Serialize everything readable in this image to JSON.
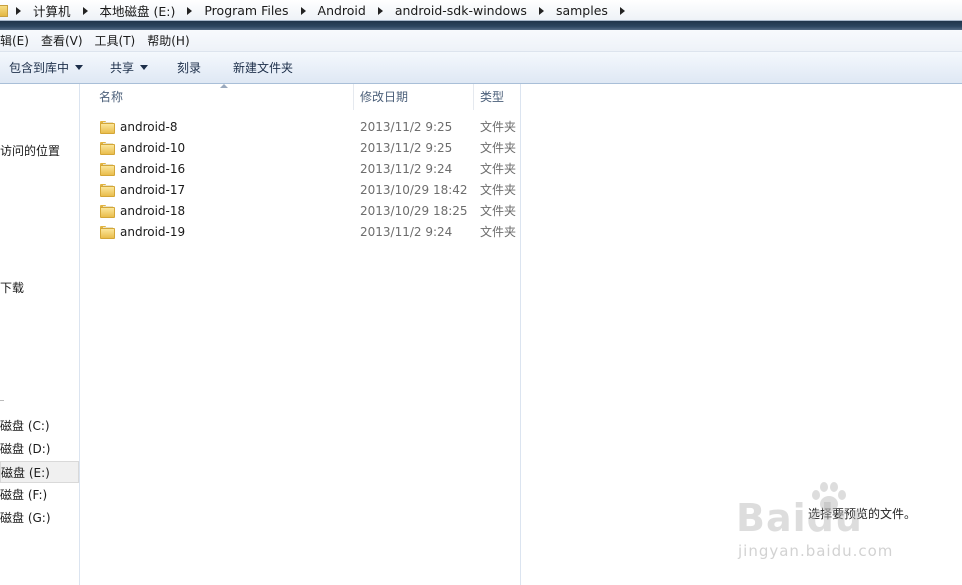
{
  "breadcrumb": {
    "items": [
      "计算机",
      "本地磁盘 (E:)",
      "Program Files",
      "Android",
      "android-sdk-windows",
      "samples"
    ]
  },
  "menu": {
    "items": [
      "辑(E)",
      "查看(V)",
      "工具(T)",
      "帮助(H)"
    ]
  },
  "toolbar": {
    "include_library": "包含到库中",
    "share": "共享",
    "burn": "刻录",
    "new_folder": "新建文件夹"
  },
  "nav": {
    "recent_places": "访问的位置",
    "downloads": "下载",
    "drives": [
      "磁盘 (C:)",
      "磁盘 (D:)",
      "磁盘 (E:)",
      "磁盘 (F:)",
      "磁盘 (G:)"
    ],
    "selected_drive": "磁盘 (E:)"
  },
  "columns": {
    "name": "名称",
    "modified": "修改日期",
    "type": "类型"
  },
  "files": [
    {
      "name": "android-8",
      "date": "2013/11/2 9:25",
      "type": "文件夹"
    },
    {
      "name": "android-10",
      "date": "2013/11/2 9:25",
      "type": "文件夹"
    },
    {
      "name": "android-16",
      "date": "2013/11/2 9:24",
      "type": "文件夹"
    },
    {
      "name": "android-17",
      "date": "2013/10/29 18:42",
      "type": "文件夹"
    },
    {
      "name": "android-18",
      "date": "2013/10/29 18:25",
      "type": "文件夹"
    },
    {
      "name": "android-19",
      "date": "2013/11/2 9:24",
      "type": "文件夹"
    }
  ],
  "preview": {
    "message": "选择要预览的文件。"
  },
  "watermark": {
    "brand": "Baidu",
    "sub": "jingyan.baidu.com"
  }
}
